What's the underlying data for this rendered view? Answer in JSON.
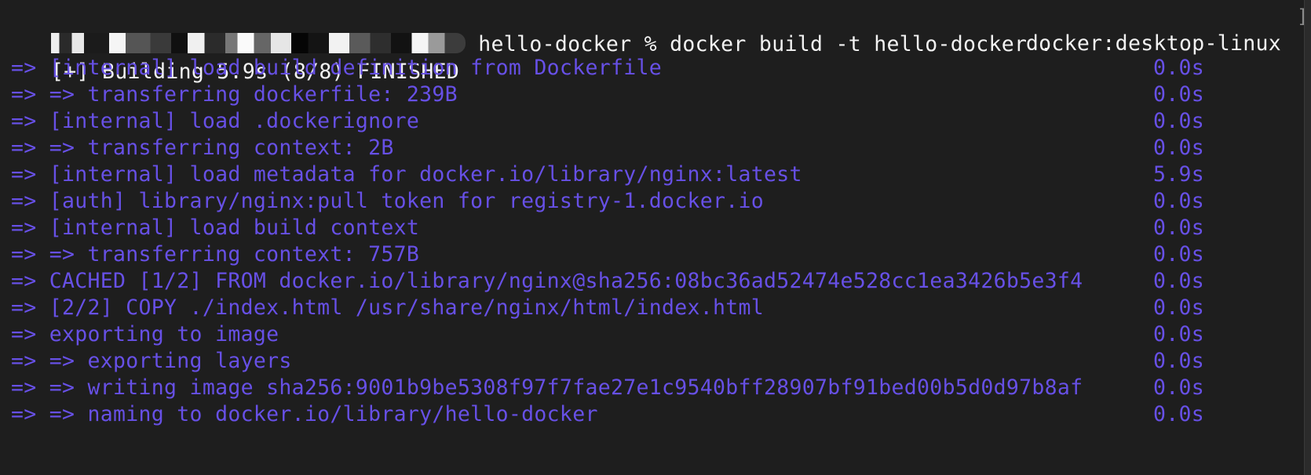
{
  "terminal": {
    "prompt": {
      "redacted_user_host": "[redacted user@host]",
      "directory": "hello-docker",
      "symbol": "%",
      "command": "docker build -t hello-docker ."
    },
    "header": {
      "status": "[+] Building 5.9s (8/8) FINISHED",
      "builder": "docker:desktop-linux"
    },
    "steps": [
      {
        "text": "=> [internal] load build definition from Dockerfile",
        "duration": "0.0s"
      },
      {
        "text": "=> => transferring dockerfile: 239B",
        "duration": "0.0s"
      },
      {
        "text": "=> [internal] load .dockerignore",
        "duration": "0.0s"
      },
      {
        "text": "=> => transferring context: 2B",
        "duration": "0.0s"
      },
      {
        "text": "=> [internal] load metadata for docker.io/library/nginx:latest",
        "duration": "5.9s"
      },
      {
        "text": "=> [auth] library/nginx:pull token for registry-1.docker.io",
        "duration": "0.0s"
      },
      {
        "text": "=> [internal] load build context",
        "duration": "0.0s"
      },
      {
        "text": "=> => transferring context: 757B",
        "duration": "0.0s"
      },
      {
        "text": "=> CACHED [1/2] FROM docker.io/library/nginx@sha256:08bc36ad52474e528cc1ea3426b5e3f4",
        "duration": "0.0s"
      },
      {
        "text": "=> [2/2] COPY ./index.html /usr/share/nginx/html/index.html",
        "duration": "0.0s"
      },
      {
        "text": "=> exporting to image",
        "duration": "0.0s"
      },
      {
        "text": "=> => exporting layers",
        "duration": "0.0s"
      },
      {
        "text": "=> => writing image sha256:9001b9be5308f97f7fae27e1c9540bff28907bf91bed00b5d0d97b8af",
        "duration": "0.0s"
      },
      {
        "text": "=> => naming to docker.io/library/hello-docker",
        "duration": "0.0s"
      }
    ],
    "scroll_bracket": "]",
    "colors": {
      "background": "#1e1e1e",
      "foreground": "#f2f2f2",
      "step_text": "#6750e6"
    }
  }
}
